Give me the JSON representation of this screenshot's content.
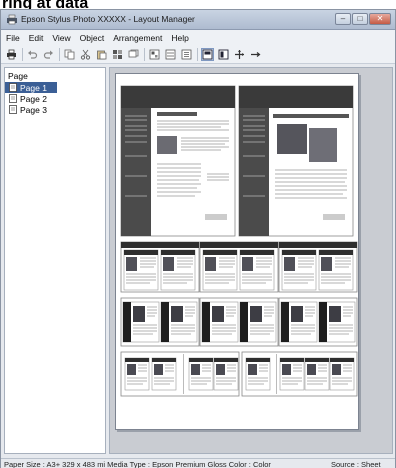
{
  "heading": "ring at data",
  "window": {
    "title": "Epson Stylus Photo XXXXX - Layout Manager",
    "buttons": {
      "minimize": "–",
      "maximize": "□",
      "close": "✕"
    }
  },
  "menu": [
    "File",
    "Edit",
    "View",
    "Object",
    "Arrangement",
    "Help"
  ],
  "toolbar": {
    "icons": [
      "print-icon",
      "undo-icon",
      "redo-icon",
      "copy-icon",
      "cut-icon",
      "paste-icon",
      "align-icon",
      "duplicate-icon",
      "arrange-icon",
      "arrange-alt-icon",
      "properties-icon",
      "layout-view-icon",
      "page-view-icon",
      "add-page-icon",
      "delete-page-icon"
    ]
  },
  "panel": {
    "title": "Page",
    "pages": [
      {
        "label": "Page 1",
        "selected": true
      },
      {
        "label": "Page 2",
        "selected": false
      },
      {
        "label": "Page 3",
        "selected": false
      }
    ]
  },
  "status": {
    "left": "Paper Size : A3+ 329 x 483 mi Media Type : Epson Premium Gloss Color : Color",
    "right": "Source : Sheet"
  },
  "colors": {
    "selection": "#3b5f96",
    "canvas": "#c9ccd2",
    "title_bar": "#aebbd0"
  }
}
